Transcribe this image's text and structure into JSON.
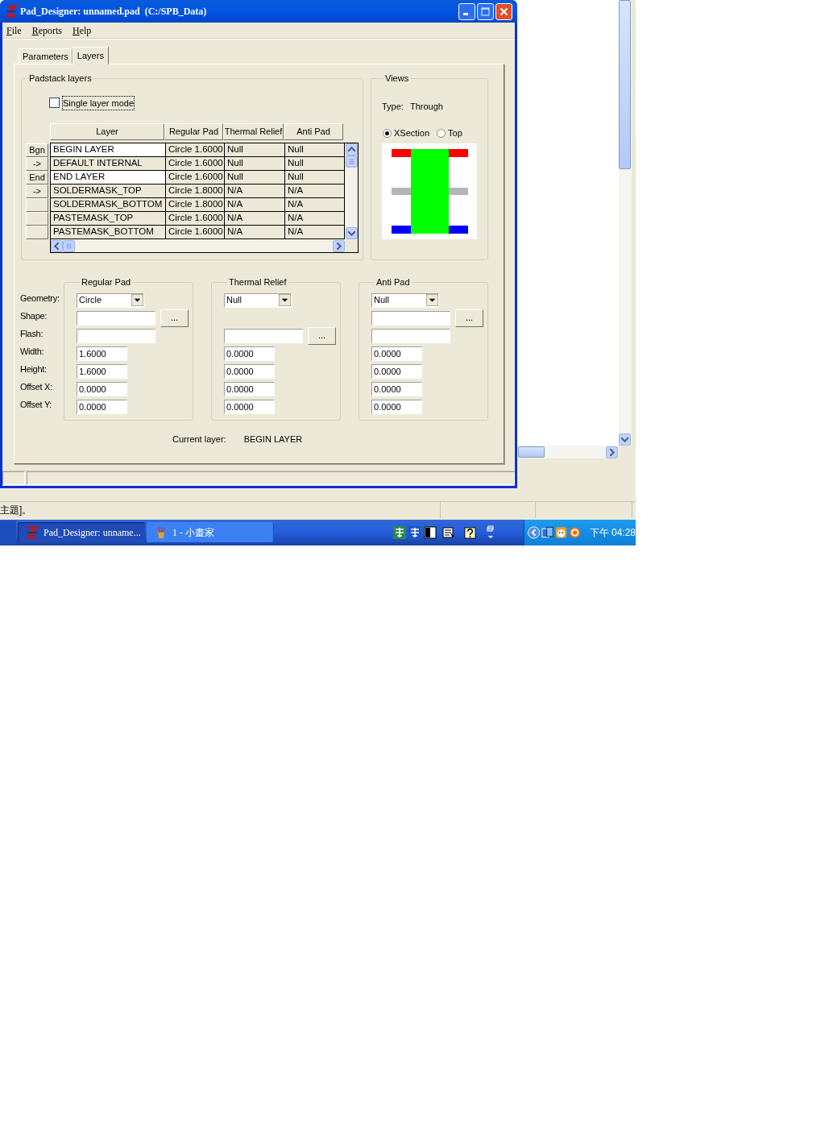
{
  "background_app": {
    "status_text": "主題]。"
  },
  "window": {
    "title": "Pad_Designer: unnamed.pad  (C:/SPB_Data)"
  },
  "menu": [
    "File",
    "Reports",
    "Help"
  ],
  "tabs": [
    {
      "label": "Parameters",
      "selected": false
    },
    {
      "label": "Layers",
      "selected": true
    }
  ],
  "padstack_layers": {
    "title": "Padstack layers",
    "single_layer_mode": {
      "label": "Single layer mode",
      "checked": false
    },
    "columns": [
      "Layer",
      "Regular Pad",
      "Thermal Relief",
      "Anti Pad"
    ],
    "rows": [
      {
        "marker": "Bgn",
        "layer": "BEGIN LAYER",
        "regular_pad": "Circle 1.6000",
        "thermal_relief": "Null",
        "anti_pad": "Null",
        "highlighted": true
      },
      {
        "marker": "->",
        "layer": "DEFAULT INTERNAL",
        "regular_pad": "Circle 1.6000",
        "thermal_relief": "Null",
        "anti_pad": "Null",
        "highlighted": false
      },
      {
        "marker": "End",
        "layer": "END LAYER",
        "regular_pad": "Circle 1.6000",
        "thermal_relief": "Null",
        "anti_pad": "Null",
        "highlighted": true
      },
      {
        "marker": "->",
        "layer": "SOLDERMASK_TOP",
        "regular_pad": "Circle 1.8000",
        "thermal_relief": "N/A",
        "anti_pad": "N/A",
        "highlighted": false
      },
      {
        "layer": "SOLDERMASK_BOTTOM",
        "regular_pad": "Circle 1.8000",
        "thermal_relief": "N/A",
        "anti_pad": "N/A",
        "highlighted": false
      },
      {
        "layer": "PASTEMASK_TOP",
        "regular_pad": "Circle 1.6000",
        "thermal_relief": "N/A",
        "anti_pad": "N/A",
        "highlighted": false
      },
      {
        "layer": "PASTEMASK_BOTTOM",
        "regular_pad": "Circle 1.6000",
        "thermal_relief": "N/A",
        "anti_pad": "N/A",
        "highlighted": false
      }
    ]
  },
  "views": {
    "title": "Views",
    "type_label": "Type:",
    "type_value": "Through",
    "modes": [
      {
        "label": "XSection",
        "selected": true
      },
      {
        "label": "Top",
        "selected": false
      }
    ]
  },
  "pad_labels": [
    "Geometry:",
    "Shape:",
    "Flash:",
    "Width:",
    "Height:",
    "Offset X:",
    "Offset Y:"
  ],
  "pad_groups": [
    {
      "title": "Regular Pad",
      "rows": [
        {
          "kind": "dropdown",
          "value": "Circle"
        },
        {
          "kind": "browse",
          "button": "..."
        },
        {
          "kind": "text"
        },
        {
          "kind": "number",
          "value": "1.6000"
        },
        {
          "kind": "number",
          "value": "1.6000"
        },
        {
          "kind": "number",
          "value": "0.0000"
        },
        {
          "kind": "number",
          "value": "0.0000"
        }
      ]
    },
    {
      "title": "Thermal Relief",
      "rows": [
        {
          "kind": "dropdown",
          "value": "Null"
        },
        {
          "kind": "none"
        },
        {
          "kind": "browse",
          "button": "..."
        },
        {
          "kind": "number",
          "value": "0.0000"
        },
        {
          "kind": "number",
          "value": "0.0000"
        },
        {
          "kind": "number",
          "value": "0.0000"
        },
        {
          "kind": "number",
          "value": "0.0000"
        }
      ]
    },
    {
      "title": "Anti Pad",
      "rows": [
        {
          "kind": "dropdown",
          "value": "Null"
        },
        {
          "kind": "browse",
          "button": "..."
        },
        {
          "kind": "text"
        },
        {
          "kind": "number",
          "value": "0.0000"
        },
        {
          "kind": "number",
          "value": "0.0000"
        },
        {
          "kind": "number",
          "value": "0.0000"
        },
        {
          "kind": "number",
          "value": "0.0000"
        }
      ]
    }
  ],
  "current_layer": {
    "label": "Current layer:",
    "value": "BEGIN LAYER"
  },
  "taskbar": {
    "buttons": [
      {
        "label": "Pad_Designer: unname...",
        "kind": "pad",
        "selected": true
      },
      {
        "label": "1 - 小畫家",
        "kind": "paint",
        "selected": false
      }
    ],
    "clock": "下午 04:28"
  }
}
